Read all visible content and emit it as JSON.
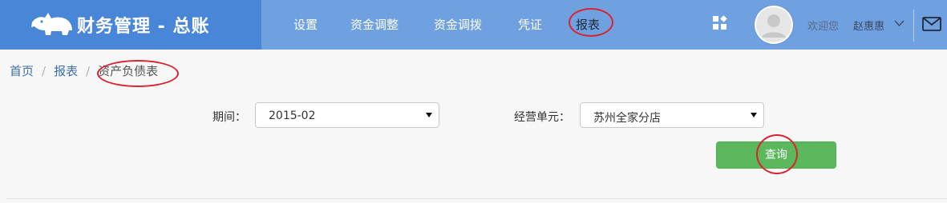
{
  "brand": {
    "title": "财务管理 - 总账",
    "logo_icon": "rhino-logo-icon"
  },
  "nav": {
    "items": [
      {
        "label": "设置"
      },
      {
        "label": "资金调整"
      },
      {
        "label": "资金调拨"
      },
      {
        "label": "凭证"
      },
      {
        "label": "报表"
      }
    ],
    "apps_icon": "apps-grid-icon"
  },
  "user": {
    "welcome": "欢迎您",
    "name": "赵惠惠",
    "avatar_icon": "user-avatar-icon",
    "dropdown_icon": "chevron-down-icon",
    "mail_icon": "mail-icon"
  },
  "breadcrumb": {
    "items": [
      "首页",
      "报表",
      "资产负债表"
    ],
    "separator": "/"
  },
  "filters": {
    "period_label": "期间：",
    "period_value": "2015-02",
    "unit_label": "经营单元：",
    "unit_value": "苏州全家分店"
  },
  "actions": {
    "query_label": "查询"
  },
  "colors": {
    "topbar": "#6fa0e0",
    "brand_bg": "#4a86d8",
    "query_button": "#5cb85c",
    "annotation_circle": "#d9232e",
    "link": "#3e6faa"
  }
}
